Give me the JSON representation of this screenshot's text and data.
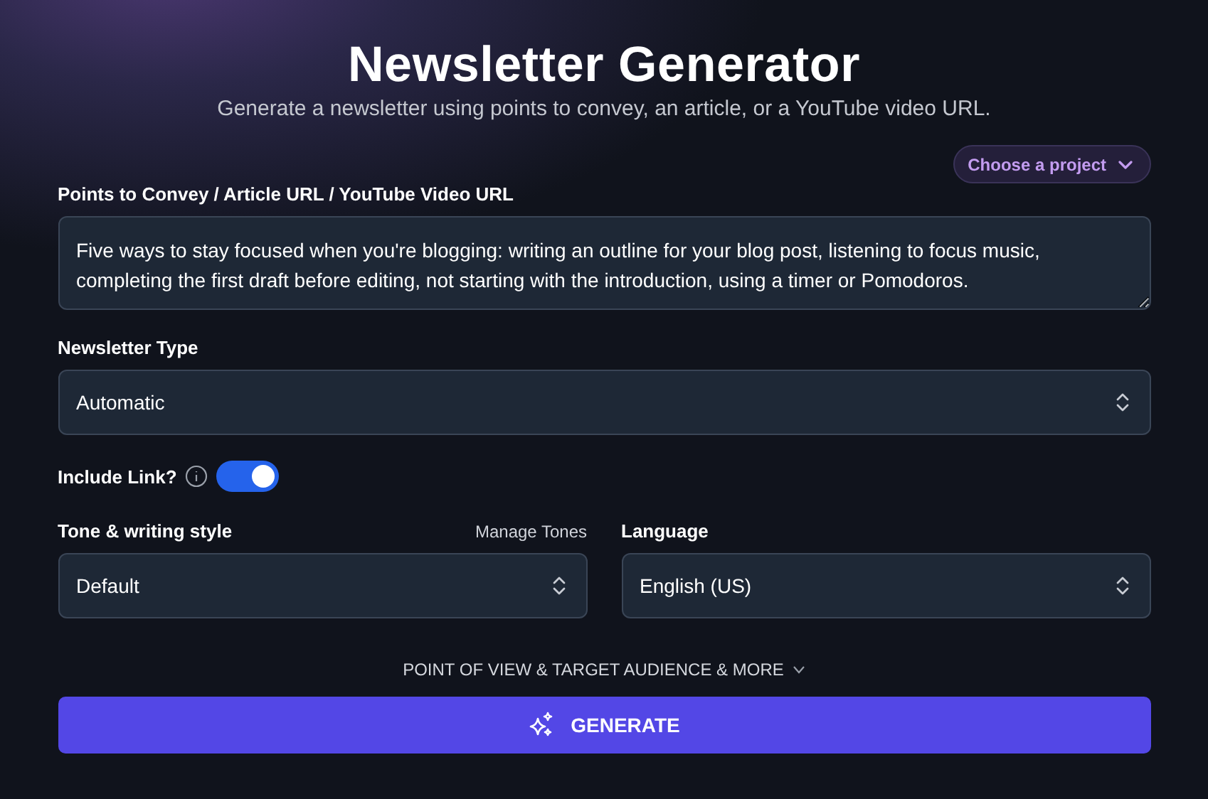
{
  "header": {
    "title": "Newsletter Generator",
    "subtitle": "Generate a newsletter using points to convey, an article, or a YouTube video URL."
  },
  "project_menu": {
    "label": "Choose a project"
  },
  "points": {
    "label": "Points to Convey / Article URL / YouTube Video URL",
    "value": "Five ways to stay focused when you're blogging: writing an outline for your blog post, listening to focus music, completing the first draft before editing, not starting with the introduction, using a timer or Pomodoros."
  },
  "newsletter_type": {
    "label": "Newsletter Type",
    "value": "Automatic"
  },
  "include_link": {
    "label": "Include Link?",
    "on": true
  },
  "tone": {
    "label": "Tone & writing style",
    "action": "Manage Tones",
    "value": "Default"
  },
  "language": {
    "label": "Language",
    "value": "English (US)"
  },
  "advanced": {
    "label": "POINT OF VIEW & TARGET AUDIENCE & MORE",
    "expanded": false
  },
  "generate_button": {
    "label": "GENERATE"
  }
}
